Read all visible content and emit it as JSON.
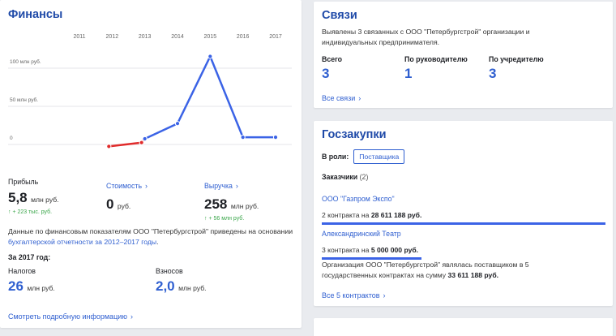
{
  "finance": {
    "title": "Финансы",
    "chart_data": {
      "type": "line",
      "categories": [
        "2011",
        "2012",
        "2013",
        "2014",
        "2015",
        "2016",
        "2017"
      ],
      "x": [
        2011.9,
        2012.9,
        2013,
        2014,
        2015,
        2016,
        2017
      ],
      "values": [
        -10,
        -5,
        0,
        20,
        108,
        2,
        2
      ],
      "y_ticks": [
        {
          "label": "100 млн руб.",
          "value": 100
        },
        {
          "label": "50 млн руб.",
          "value": 50
        },
        {
          "label": "0",
          "value": 0
        }
      ],
      "ylim": [
        -15,
        120
      ],
      "grid": true,
      "colors": {
        "negative": "#e02b2b",
        "positive": "#3b63e6"
      }
    },
    "metrics": [
      {
        "label": "Прибыль",
        "value": "5,8",
        "unit": "млн руб.",
        "delta": "↑ + 223 тыс. руб."
      },
      {
        "label": "Стоимость",
        "value": "0",
        "unit": "руб."
      },
      {
        "label": "Выручка",
        "value": "258",
        "unit": "млн руб.",
        "delta": "↑ + 56 млн руб."
      }
    ],
    "note_prefix": "Данные по финансовым показателям ООО \"Петербургстрой\" приведены на основании ",
    "note_link": "бухгалтерской отчетности за 2012–2017 годы",
    "note_suffix": ".",
    "year_title": "За 2017 год:",
    "taxes_label": "Налогов",
    "taxes_value": "26",
    "taxes_unit": "млн руб.",
    "fees_label": "Взносов",
    "fees_value": "2,0",
    "fees_unit": "млн руб.",
    "more_link": "Смотреть подробную информацию"
  },
  "links": {
    "title": "Связи",
    "desc": "Выявлены 3 связанных с ООО \"Петербургстрой\" организации и индивидуальных предпринимателя.",
    "stats": [
      {
        "label": "Всего",
        "value": "3"
      },
      {
        "label": "По руководителю",
        "value": "1"
      },
      {
        "label": "По учредителю",
        "value": "3"
      }
    ],
    "all_link": "Все связи"
  },
  "procurement": {
    "title": "Госзакупки",
    "role_label": "В роли:",
    "role_badge": "Поставщика",
    "customers_label": "Заказчики",
    "customers_count": "(2)",
    "customers": [
      {
        "name": "ООО \"Газпром Экспо\"",
        "contracts": "2 контракта на",
        "amount": "28 611 188 руб.",
        "share": 1.0
      },
      {
        "name": "Александринский Театр",
        "contracts": "3 контракта на",
        "amount": "5 000 000 руб.",
        "share": 0.35
      }
    ],
    "summary_prefix": "Организация ООО \"Петербургстрой\" являлась поставщиком в 5 государственных контрактах на сумму ",
    "summary_amount": "33 611 188 руб.",
    "all_contracts": "Все 5 контрактов"
  },
  "colors": {
    "accent": "#2f5fd0",
    "title": "#1f4aa8",
    "bar": "#3b63e6"
  }
}
